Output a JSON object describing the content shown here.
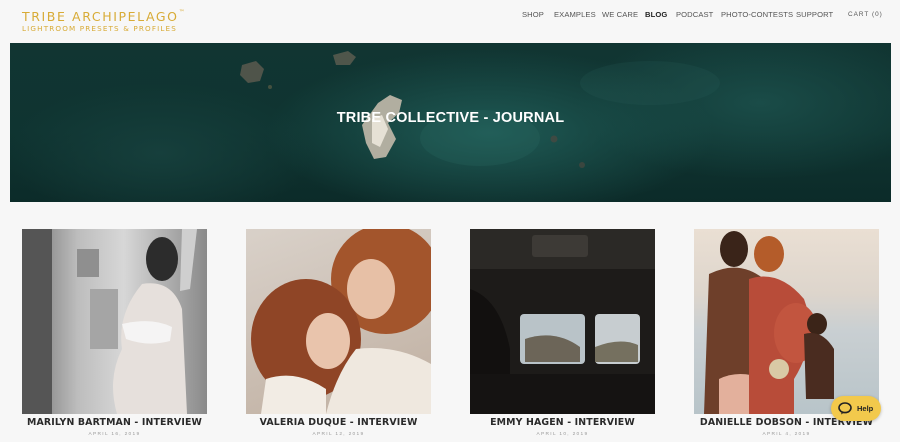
{
  "logo": {
    "title": "TRIBE ARCHIPELAGO",
    "tm": "™",
    "subtitle": "LIGHTROOM PRESETS & PROFILES"
  },
  "nav": {
    "items": [
      {
        "label": "SHOP"
      },
      {
        "label": "EXAMPLES"
      },
      {
        "label": "WE CARE"
      },
      {
        "label": "BLOG",
        "active": true
      },
      {
        "label": "PODCAST"
      },
      {
        "label": "PHOTO-CONTESTS"
      },
      {
        "label": "SUPPORT"
      }
    ],
    "cart": "CART (0)"
  },
  "hero": {
    "title": "TRIBE COLLECTIVE - JOURNAL"
  },
  "posts": [
    {
      "title": "MARILYN BARTMAN - INTERVIEW",
      "date": "APRIL 16, 2019"
    },
    {
      "title": "VALERIA DUQUE - INTERVIEW",
      "date": "APRIL 12, 2019"
    },
    {
      "title": "EMMY HAGEN - INTERVIEW",
      "date": "APRIL 10, 2019"
    },
    {
      "title": "DANIELLE DOBSON - INTERVIEW",
      "date": "APRIL 4, 2019"
    }
  ],
  "help": {
    "label": "Help",
    "icon": "chat-bubble-icon"
  },
  "colors": {
    "brand_gold": "#d8ab36",
    "hero_teal": "#0f3431",
    "help_yellow": "#f2c94c"
  }
}
